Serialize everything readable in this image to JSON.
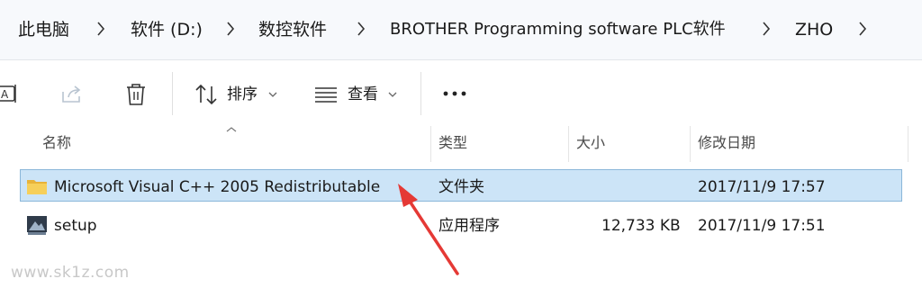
{
  "breadcrumb": {
    "items": [
      "此电脑",
      "软件 (D:)",
      "数控软件",
      "BROTHER Programming software PLC软件",
      "ZHO"
    ]
  },
  "toolbar": {
    "sort_label": "排序",
    "view_label": "查看",
    "more_label": "•••"
  },
  "columns": {
    "name": "名称",
    "type": "类型",
    "size": "大小",
    "modified": "修改日期"
  },
  "files": [
    {
      "name": "Microsoft Visual C++ 2005 Redistributable",
      "type": "文件夹",
      "size": "",
      "modified": "2017/11/9 17:57",
      "icon": "folder-icon",
      "selected": true
    },
    {
      "name": "setup",
      "type": "应用程序",
      "size": "12,733 KB",
      "modified": "2017/11/9 17:51",
      "icon": "setup-app-icon",
      "selected": false
    }
  ],
  "watermark": "www.sk1z.com",
  "colors": {
    "selection": "#cce4f7",
    "selection_border": "#8bb7d9",
    "folder": "#f2c94c",
    "arrow": "#e53935"
  }
}
